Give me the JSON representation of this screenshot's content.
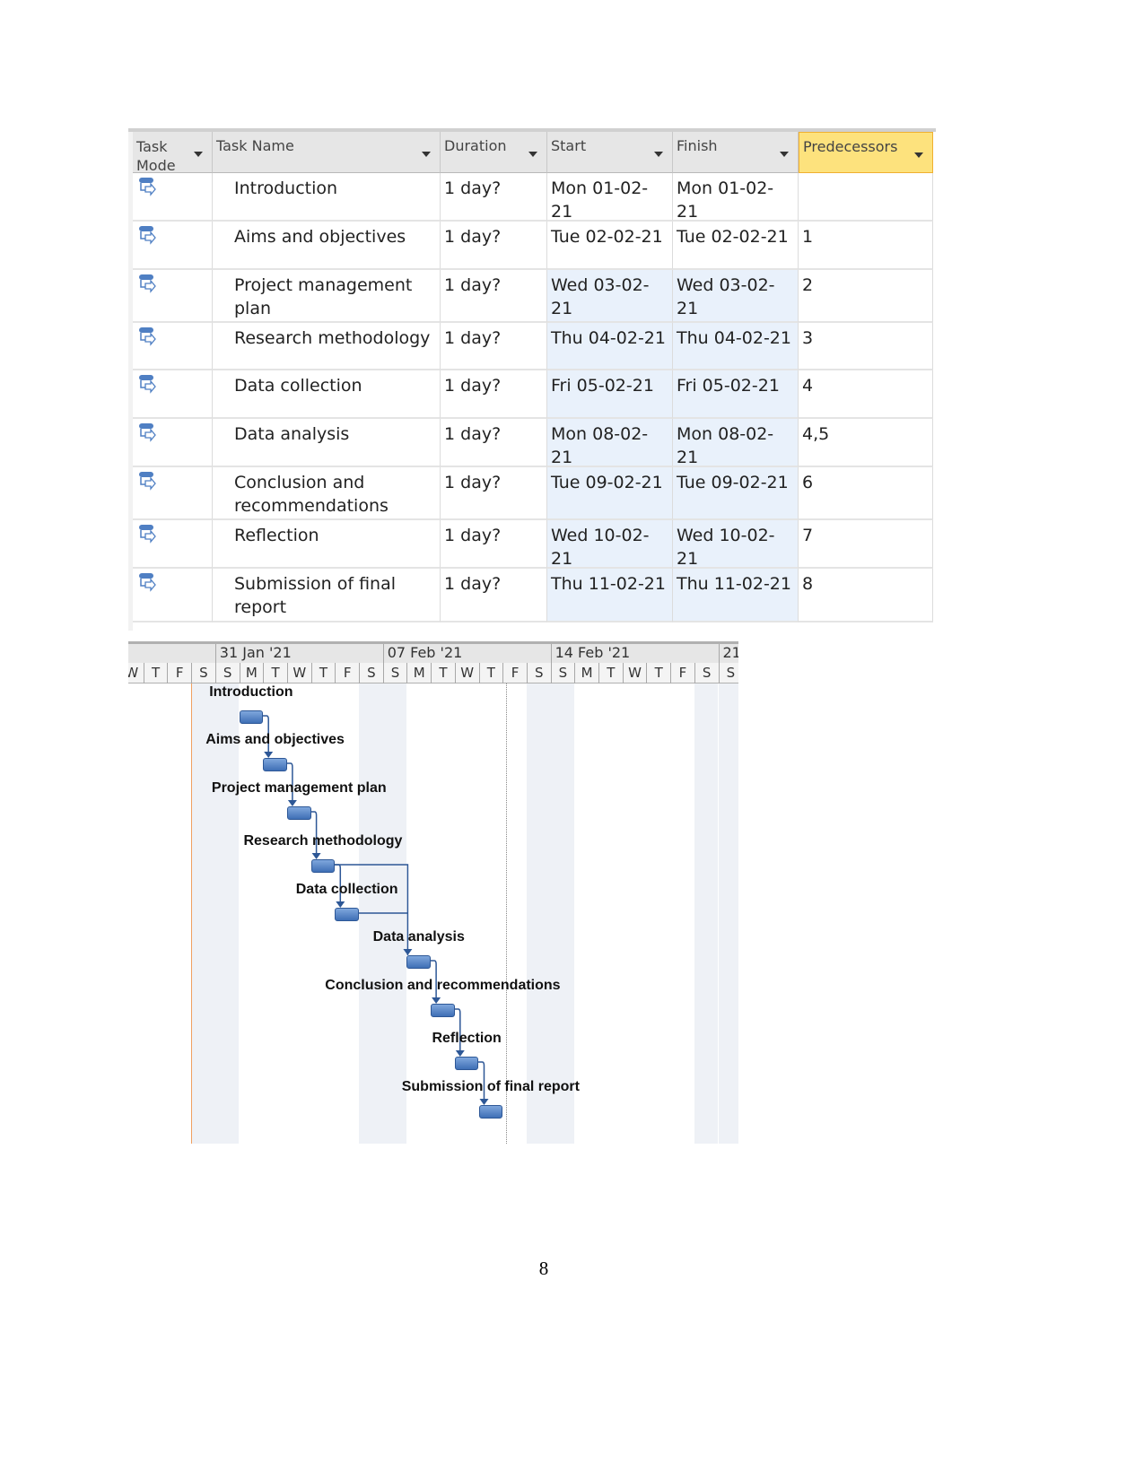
{
  "table": {
    "columns": [
      "Task Mode",
      "Task Name",
      "Duration",
      "Start",
      "Finish",
      "Predecessors"
    ],
    "rows": [
      {
        "name": "Introduction",
        "duration": "1 day?",
        "start": "Mon 01-02-21",
        "finish": "Mon 01-02-21",
        "pred": ""
      },
      {
        "name": "Aims and objectives",
        "duration": "1 day?",
        "start": "Tue 02-02-21",
        "finish": "Tue 02-02-21",
        "pred": "1"
      },
      {
        "name": "Project management plan",
        "duration": "1 day?",
        "start": "Wed 03-02-21",
        "finish": "Wed 03-02-21",
        "pred": "2"
      },
      {
        "name": "Research methodology",
        "duration": "1 day?",
        "start": "Thu 04-02-21",
        "finish": "Thu 04-02-21",
        "pred": "3"
      },
      {
        "name": "Data collection",
        "duration": "1 day?",
        "start": "Fri 05-02-21",
        "finish": "Fri 05-02-21",
        "pred": "4"
      },
      {
        "name": "Data analysis",
        "duration": "1 day?",
        "start": "Mon 08-02-21",
        "finish": "Mon 08-02-21",
        "pred": "4,5"
      },
      {
        "name": "Conclusion and recommendations",
        "duration": "1 day?",
        "start": "Tue 09-02-21",
        "finish": "Tue 09-02-21",
        "pred": "6"
      },
      {
        "name": "Reflection",
        "duration": "1 day?",
        "start": "Wed 10-02-21",
        "finish": "Wed 10-02-21",
        "pred": "7"
      },
      {
        "name": "Submission of final report",
        "duration": "1 day?",
        "start": "Thu 11-02-21",
        "finish": "Thu 11-02-21",
        "pred": "8"
      }
    ],
    "task_mode_icon": "auto-scheduled-task-icon",
    "highlight_color": "#fde27d"
  },
  "gantt": {
    "weeks": [
      "31 Jan '21",
      "07 Feb '21",
      "14 Feb '21",
      "21"
    ],
    "days": [
      "W",
      "T",
      "F",
      "S",
      "S",
      "M",
      "T",
      "W",
      "T",
      "F",
      "S",
      "S",
      "M",
      "T",
      "W",
      "T",
      "F",
      "S",
      "S",
      "M",
      "T",
      "W",
      "T",
      "F",
      "S",
      "S"
    ],
    "bar_color": "#4f7fc3",
    "task_day_index": [
      5,
      6,
      7,
      8,
      9,
      12,
      13,
      14,
      15
    ]
  },
  "page_number": "8"
}
